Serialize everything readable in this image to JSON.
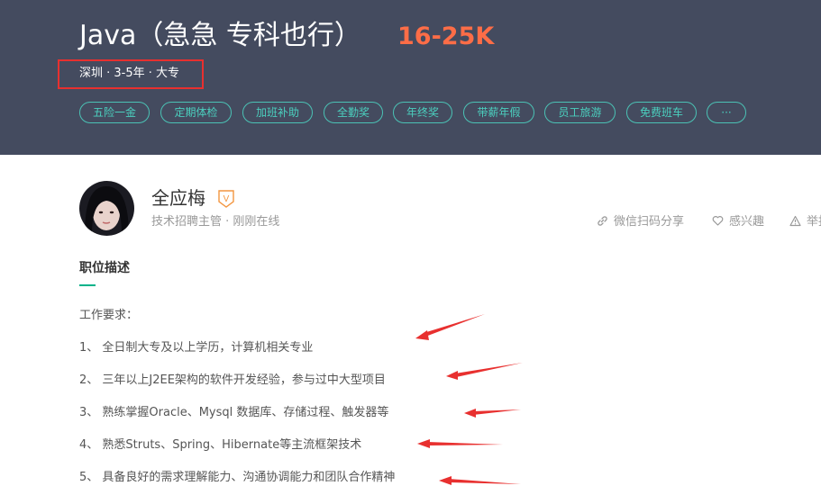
{
  "job": {
    "title": "Java（急急 专科也行）",
    "salary": "16-25K",
    "meta": "深圳 · 3-5年 · 大专"
  },
  "tags": [
    "五险一金",
    "定期体检",
    "加班补助",
    "全勤奖",
    "年终奖",
    "带薪年假",
    "员工旅游",
    "免费班车",
    "···"
  ],
  "recruiter": {
    "name": "全应梅",
    "badge": "V",
    "role": "技术招聘主管 · 刚刚在线"
  },
  "actions": {
    "share": "微信扫码分享",
    "interest": "感兴趣",
    "report": "举报"
  },
  "description": {
    "title": "职位描述",
    "lines": [
      "工作要求：",
      "1、 全日制大专及以上学历，计算机相关专业",
      "2、 三年以上J2EE架构的软件开发经验，参与过中大型项目",
      "3、 熟练掌握Oracle、Mysql 数据库、存储过程、触发器等",
      "4、 熟悉Struts、Spring、Hibernate等主流框架技术",
      "5、 具备良好的需求理解能力、沟通协调能力和团队合作精神"
    ]
  },
  "colors": {
    "header_bg": "#444b5f",
    "salary": "#fd6d47",
    "tag": "#4bd0bf",
    "highlight": "#e8302f",
    "accent": "#00b38a"
  }
}
